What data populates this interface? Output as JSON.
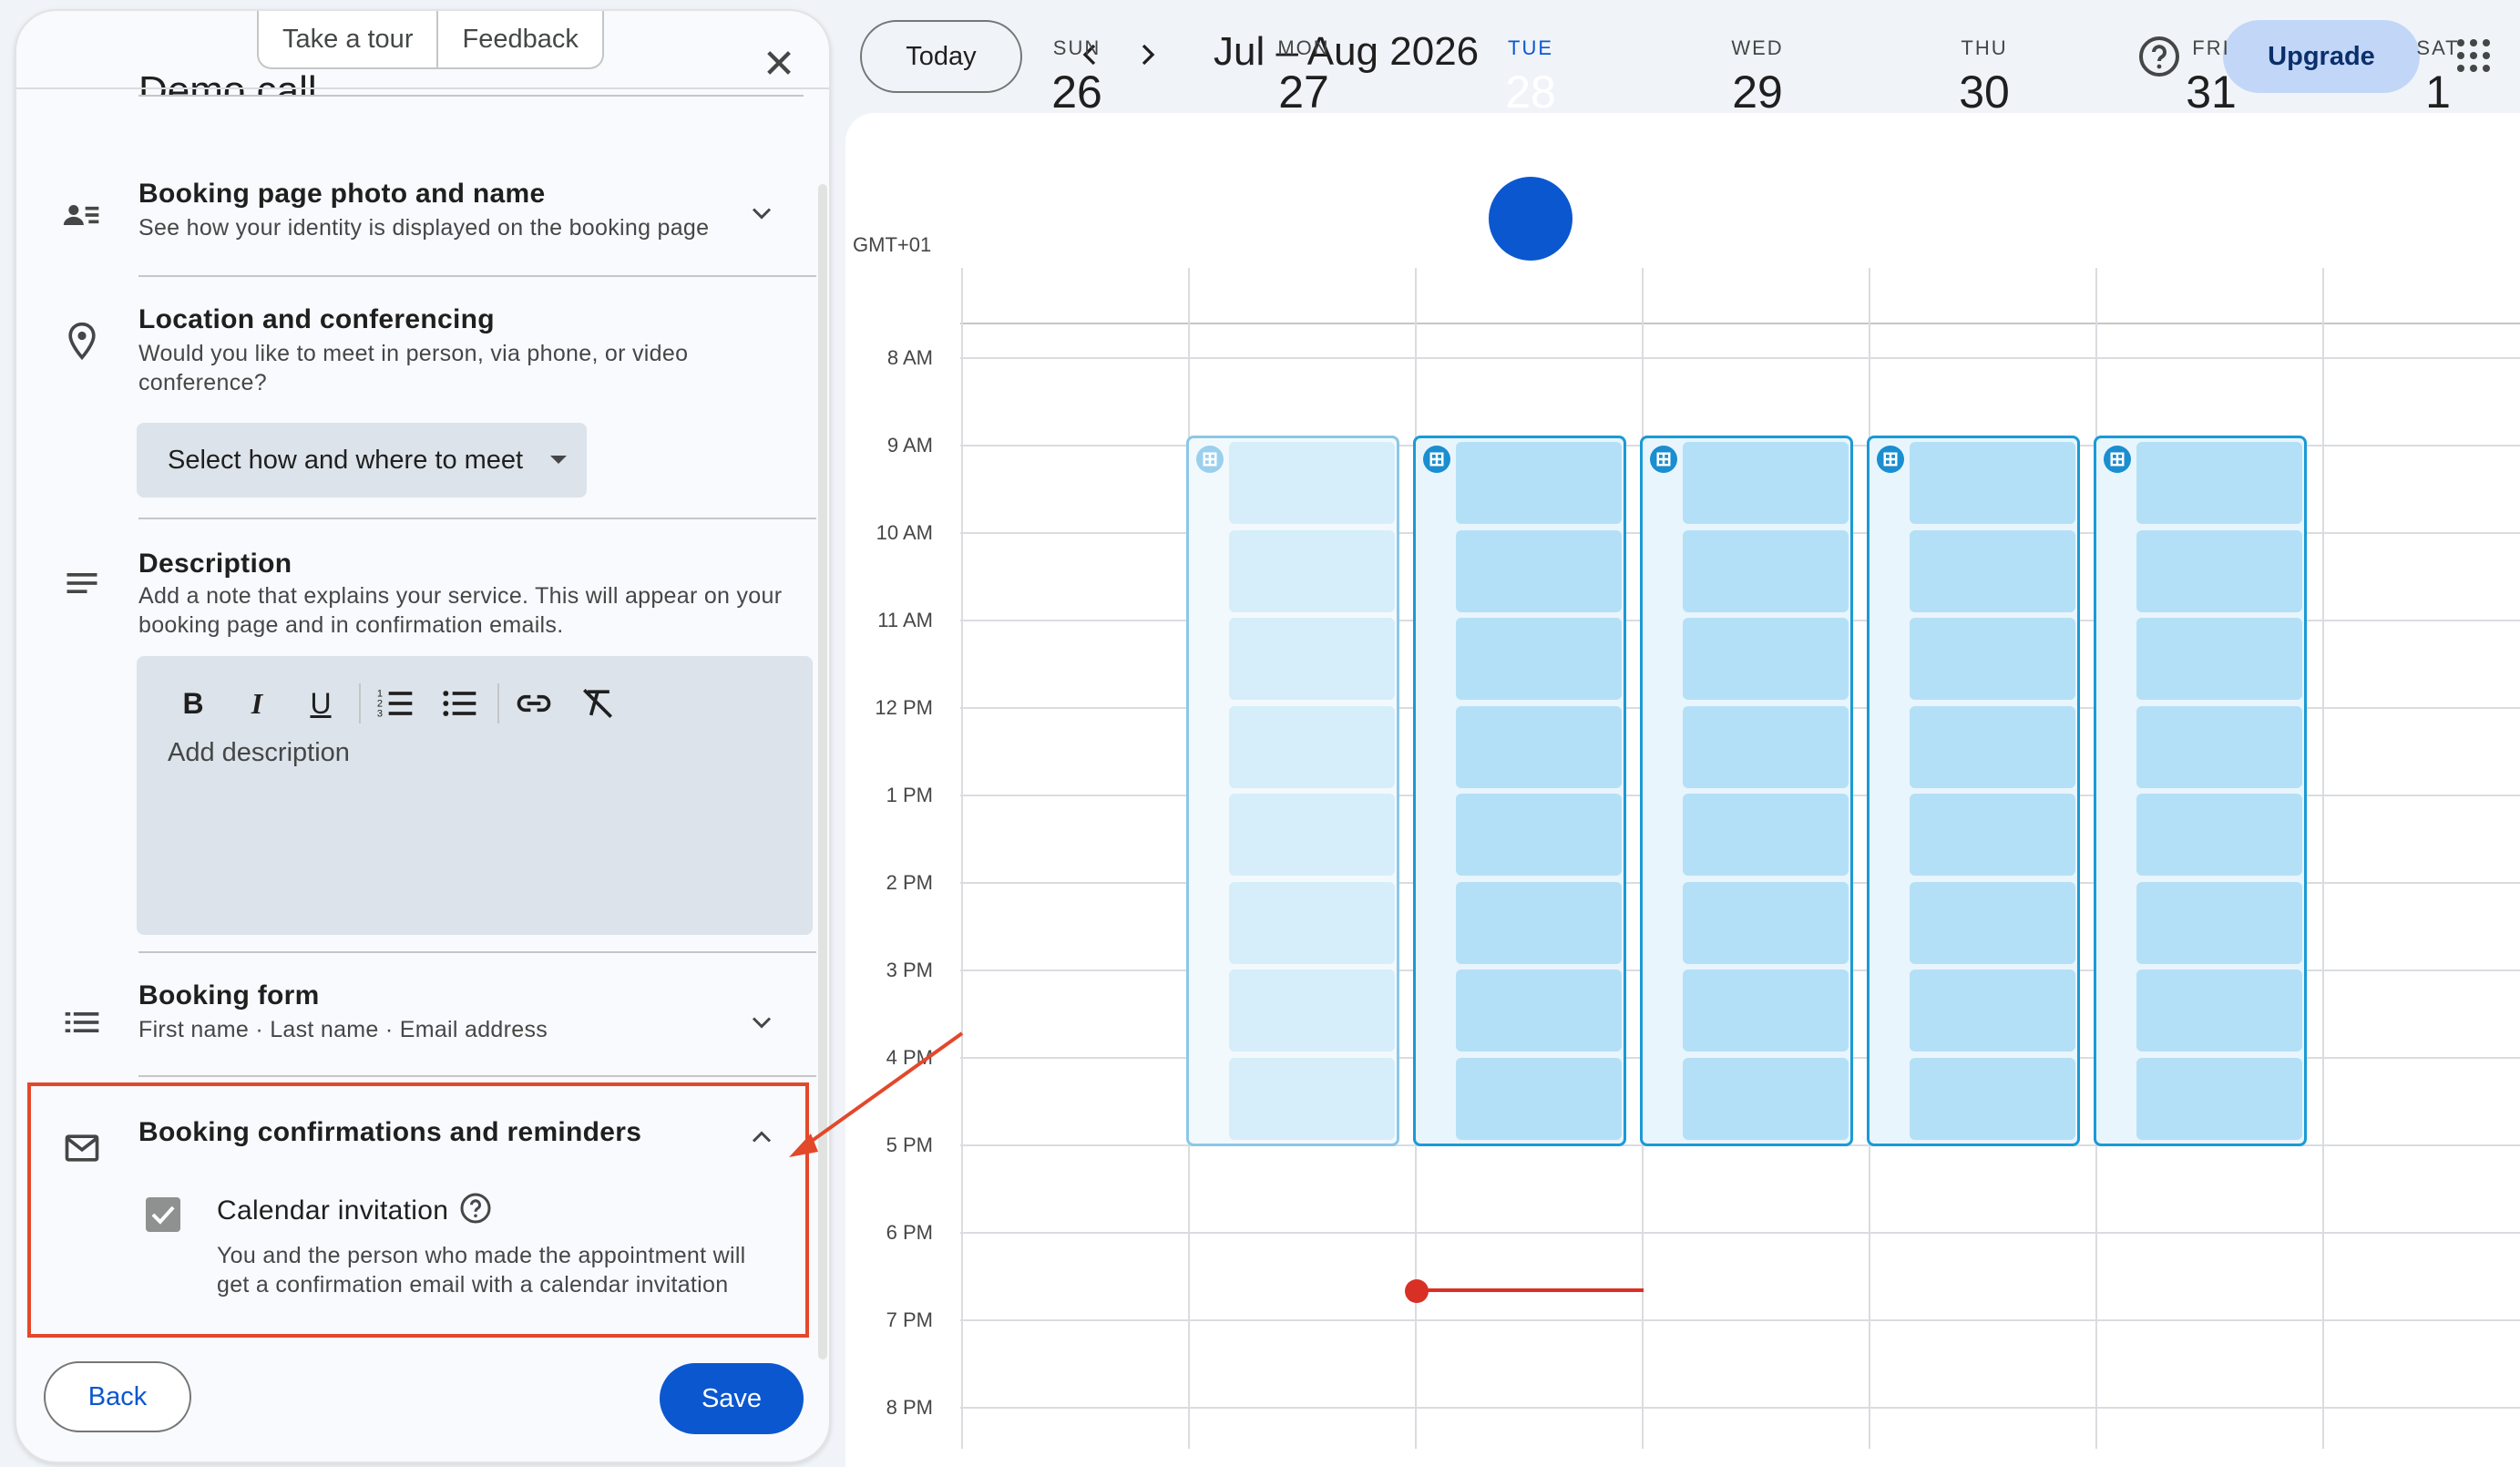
{
  "panel": {
    "take_tour": "Take a tour",
    "feedback": "Feedback",
    "event_title": "Demo call",
    "sections": {
      "photo": {
        "title": "Booking page photo and name",
        "subtitle": "See how your identity is displayed on the booking page"
      },
      "location": {
        "title": "Location and conferencing",
        "subtitle_1": "Would you like to meet in person, via phone, or video",
        "subtitle_2": "conference?",
        "select_label": "Select how and where to meet"
      },
      "description": {
        "title": "Description",
        "subtitle_1": "Add a note that explains your service. This will appear on your",
        "subtitle_2": "booking page and in confirmation emails.",
        "placeholder": "Add description"
      },
      "form": {
        "title": "Booking form",
        "subtitle": "First name · Last name · Email address"
      },
      "confirm": {
        "title": "Booking confirmations and reminders",
        "checkbox_label": "Calendar invitation",
        "checkbox_checked": true,
        "checkbox_sub_1": "You and the person who made the appointment will",
        "checkbox_sub_2": "get a confirmation email with a calendar invitation"
      }
    },
    "back_label": "Back",
    "save_label": "Save"
  },
  "header": {
    "today_label": "Today",
    "date_range": "Jul – Aug 2026",
    "upgrade_label": "Upgrade"
  },
  "calendar": {
    "timezone": "GMT+01",
    "days": [
      {
        "dow": "SUN",
        "dom": "26"
      },
      {
        "dow": "MON",
        "dom": "27"
      },
      {
        "dow": "TUE",
        "dom": "28"
      },
      {
        "dow": "WED",
        "dom": "29"
      },
      {
        "dow": "THU",
        "dom": "30"
      },
      {
        "dow": "FRI",
        "dom": "31"
      },
      {
        "dow": "SAT",
        "dom": "1"
      }
    ],
    "today_index": 2,
    "times": [
      "8 AM",
      "9 AM",
      "10 AM",
      "11 AM",
      "12 PM",
      "1 PM",
      "2 PM",
      "3 PM",
      "4 PM",
      "5 PM",
      "6 PM",
      "7 PM",
      "8 PM"
    ],
    "availability_range": "9 AM – 5 PM",
    "colors": {
      "accent": "#0b57d0",
      "block_border": "#1a9ad6",
      "slot": "#b3e0f6",
      "now": "#d93025",
      "highlight": "#e3482a"
    }
  }
}
